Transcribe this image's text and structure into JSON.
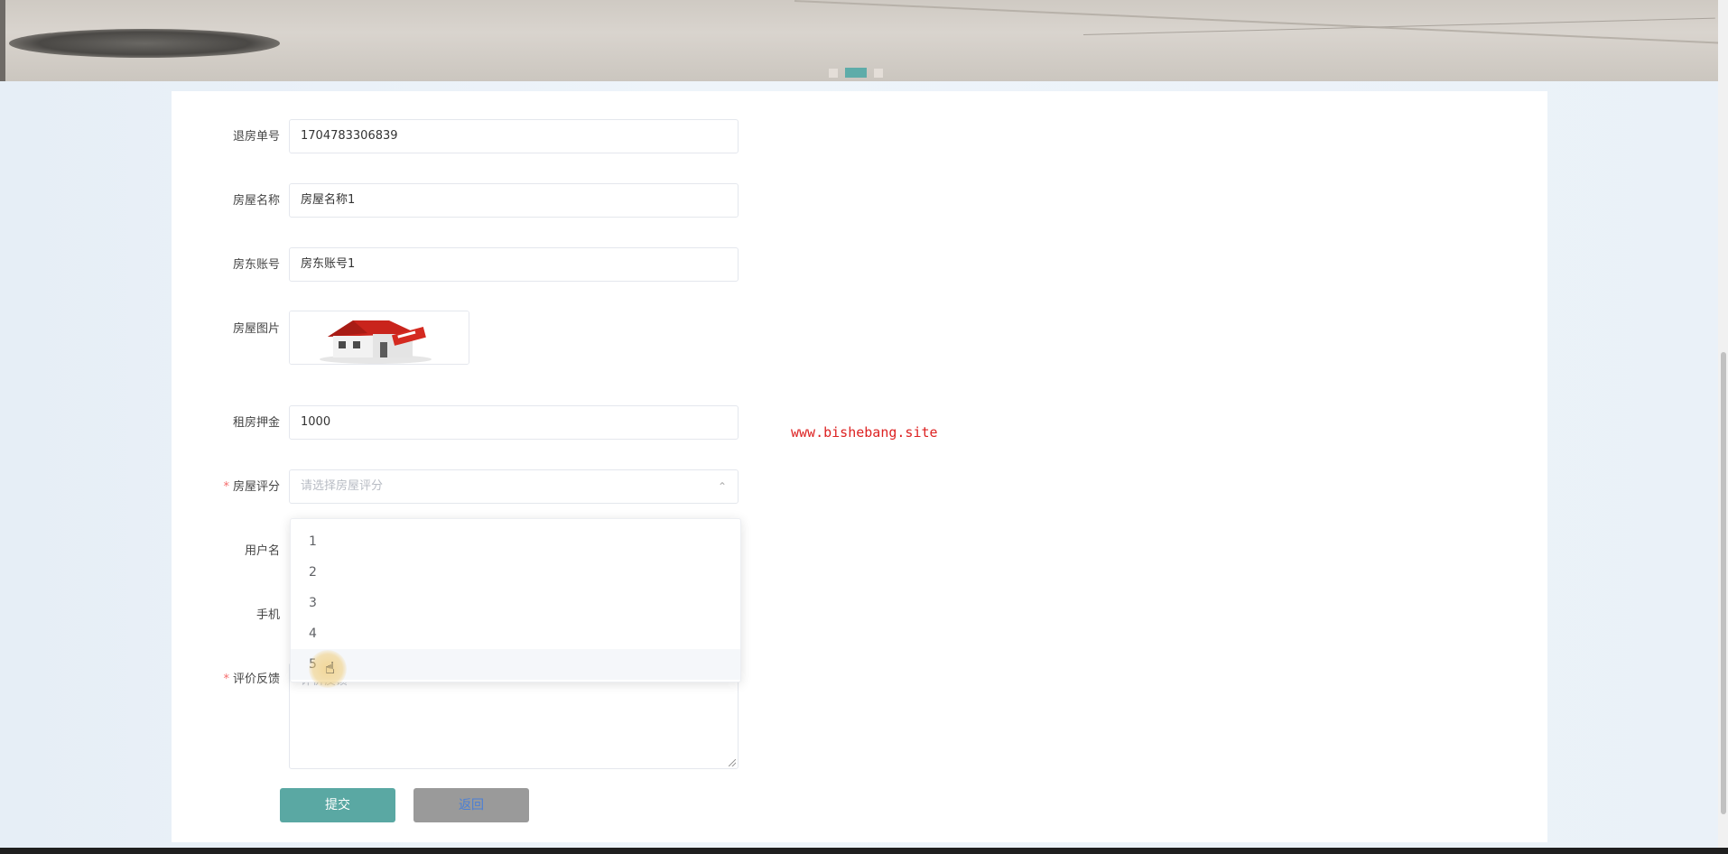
{
  "form": {
    "fields": [
      {
        "label": "退房单号",
        "value": "1704783306839",
        "required": false
      },
      {
        "label": "房屋名称",
        "value": "房屋名称1",
        "required": false
      },
      {
        "label": "房东账号",
        "value": "房东账号1",
        "required": false
      },
      {
        "label": "房屋图片",
        "value": "",
        "required": false
      },
      {
        "label": "租房押金",
        "value": "1000",
        "required": false
      },
      {
        "label": "房屋评分",
        "placeholder": "请选择房屋评分",
        "required": true
      },
      {
        "label": "用户名",
        "required": false
      },
      {
        "label": "手机",
        "required": false
      },
      {
        "label": "评价反馈",
        "placeholder": "评价反馈",
        "required": true
      }
    ],
    "rating_options": [
      "1",
      "2",
      "3",
      "4",
      "5"
    ],
    "hovered_option": "5",
    "required_mark": "*",
    "submit_label": "提交",
    "back_label": "返回"
  },
  "watermark": "www.bishebang.site",
  "banner": {
    "carousel_dots": 3,
    "active_dot": 2
  },
  "colors": {
    "accent": "#5aa8a3",
    "required": "#f56c6c",
    "watermark": "#dd2222",
    "back_button": "#9a9a9a"
  }
}
